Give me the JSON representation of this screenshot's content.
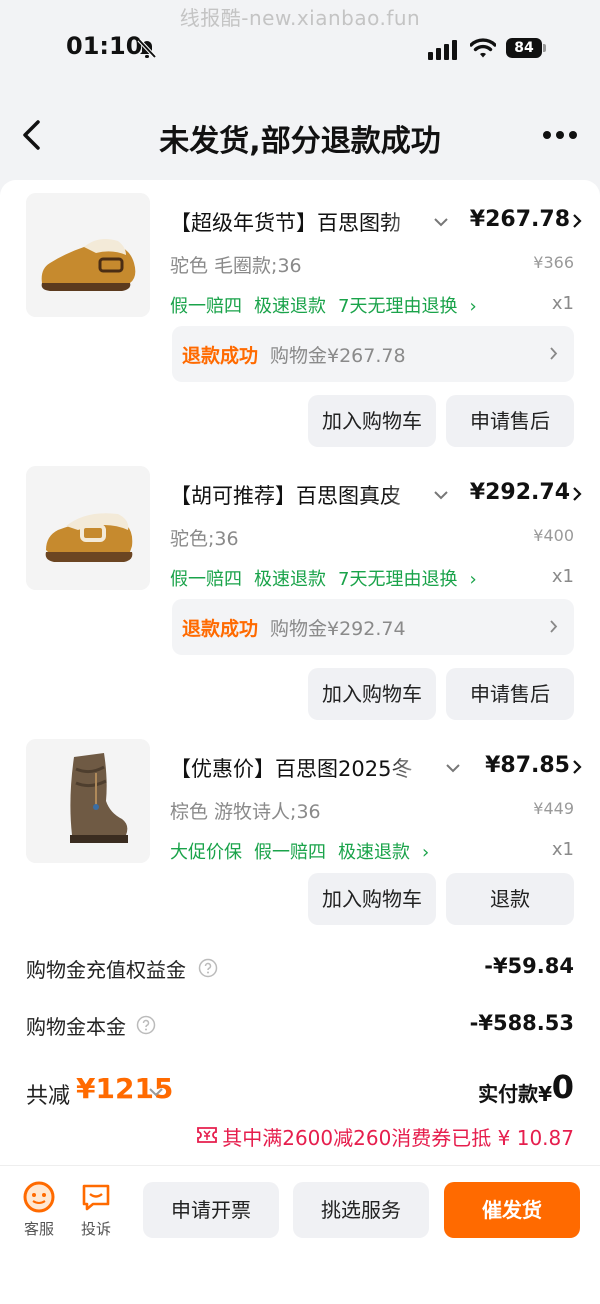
{
  "watermark": "线报酷-new.xianbao.fun",
  "status_bar": {
    "time": "01:10",
    "battery": "84"
  },
  "header": {
    "title": "未发货,部分退款成功"
  },
  "items": [
    {
      "title": "【超级年货节】百思图勃",
      "price": "¥267.78",
      "spec": "驼色 毛圈款;36",
      "original_price": "¥366",
      "tags": [
        "假一赔四",
        "极速退款",
        "7天无理由退换"
      ],
      "quantity": "x1",
      "refund": {
        "status": "退款成功",
        "desc": "购物金¥267.78"
      },
      "buttons": [
        "加入购物车",
        "申请售后"
      ]
    },
    {
      "title": "【胡可推荐】百思图真皮",
      "price": "¥292.74",
      "spec": "驼色;36",
      "original_price": "¥400",
      "tags": [
        "假一赔四",
        "极速退款",
        "7天无理由退换"
      ],
      "quantity": "x1",
      "refund": {
        "status": "退款成功",
        "desc": "购物金¥292.74"
      },
      "buttons": [
        "加入购物车",
        "申请售后"
      ]
    },
    {
      "title": "【优惠价】百思图2025冬",
      "price": "¥87.85",
      "spec": "棕色 游牧诗人;36",
      "original_price": "¥449",
      "tags": [
        "大促价保",
        "假一赔四",
        "极速退款"
      ],
      "quantity": "x1",
      "buttons": [
        "加入购物车",
        "退款"
      ]
    }
  ],
  "summary": {
    "rows": [
      {
        "label": "购物金充值权益金",
        "value": "-¥59.84"
      },
      {
        "label": "购物金本金",
        "value": "-¥588.53"
      }
    ],
    "total_label": "共减",
    "total_amount": "¥1215",
    "pay_label": "实付款¥",
    "pay_value": "0",
    "coupon_text": "其中满2600减260消费券已抵 ¥ 10.87"
  },
  "bottom_bar": {
    "service_label": "客服",
    "complaint_label": "投诉",
    "buttons": [
      "申请开票",
      "挑选服务",
      "催发货"
    ]
  },
  "colors": {
    "accent": "#ff6a00",
    "tag_green": "#1aa34a",
    "coupon_red": "#e61e4d"
  }
}
